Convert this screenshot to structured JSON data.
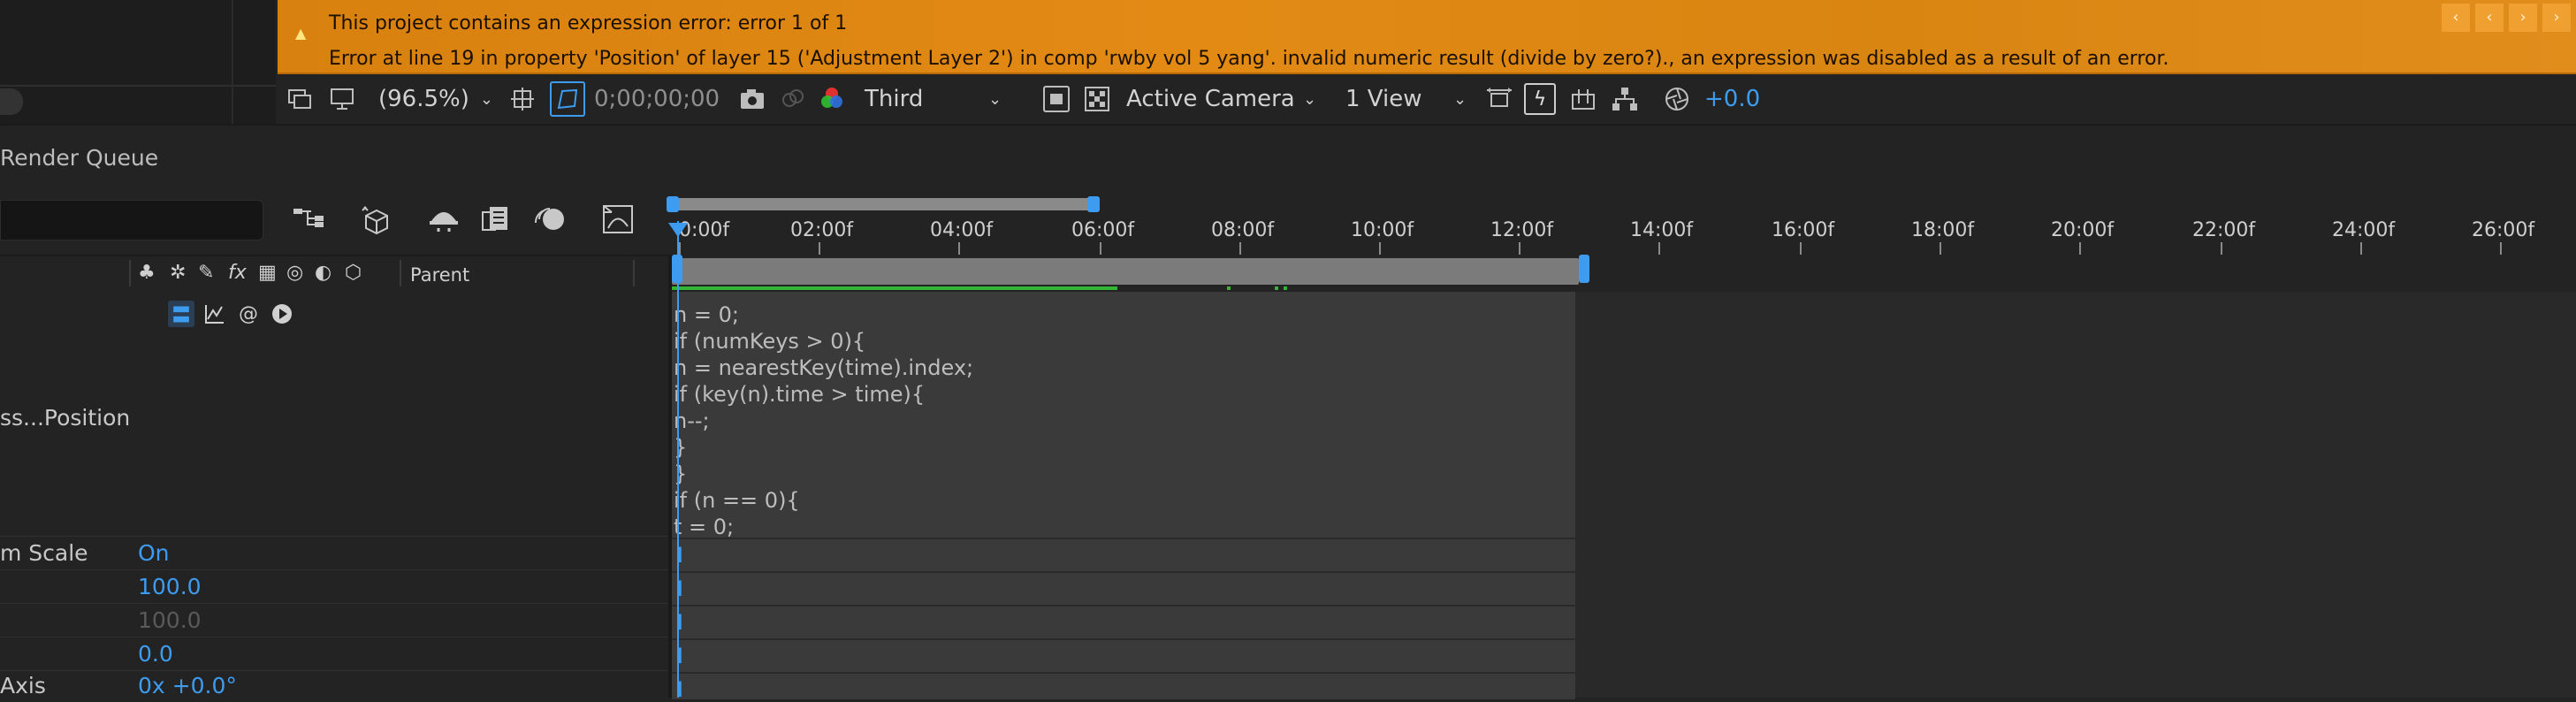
{
  "error_banner": {
    "line1": "This project contains an expression error: error 1 of 1",
    "line2": "Error at line 19 in property 'Position' of layer 15 ('Adjustment Layer 2') in comp 'rwby vol 5 yang'. invalid numeric result (divide by zero?)., an expression was disabled as a result of an error.",
    "nav": [
      "‹",
      "‹",
      "›",
      "›"
    ]
  },
  "viewer_toolbar": {
    "zoom": "(96.5%)",
    "timecode": "0;00;00;00",
    "resolution": "Third",
    "camera": "Active Camera",
    "view": "1 View",
    "exposure": "+0.0"
  },
  "panels": {
    "render_queue_label": "Render Queue"
  },
  "timeline": {
    "ruler_ticks": [
      "0:00f",
      "02:00f",
      "04:00f",
      "06:00f",
      "08:00f",
      "10:00f",
      "12:00f",
      "14:00f",
      "16:00f",
      "18:00f",
      "20:00f",
      "22:00f",
      "24:00f",
      "26:00f"
    ],
    "parent_label": "Parent",
    "switch_icons": [
      "♣",
      "✲",
      "✎",
      "fx",
      "▦",
      "◎",
      "◐",
      "⬡"
    ]
  },
  "properties": [
    {
      "name": "ss...Position",
      "value": ""
    },
    {
      "name": "m Scale",
      "value": "On"
    },
    {
      "name": "",
      "value": "100.0"
    },
    {
      "name": "",
      "value": "100.0",
      "dim": true
    },
    {
      "name": "",
      "value": "0.0"
    },
    {
      "name": "Axis",
      "value": "0x +0.0°"
    }
  ],
  "expression_code": [
    "n = 0;",
    "if (numKeys > 0){",
    "n = nearestKey(time).index;",
    "if (key(n).time > time){",
    "n--;",
    "}",
    "}",
    "if (n == 0){",
    "t = 0;"
  ],
  "colors": {
    "accent": "#3d9cf0",
    "banner": "#e08a14",
    "green": "#35b535"
  }
}
